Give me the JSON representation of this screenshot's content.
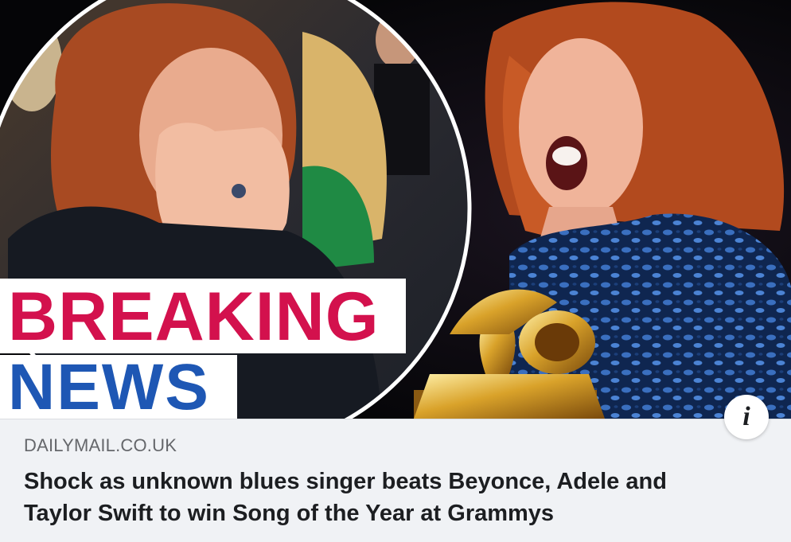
{
  "post": {
    "badge": {
      "line1": "BREAKING",
      "line2": "NEWS"
    },
    "info_icon": "info-icon",
    "info_glyph": "i",
    "domain": "DAILYMAIL.CO.UK",
    "headline": "Shock as unknown blues singer beats Beyonce, Adele and Taylor Swift to win Song of the Year at Grammys"
  },
  "colors": {
    "breaking_red": "#d3114d",
    "news_blue": "#1e57b4",
    "meta_background": "#f0f2f5",
    "domain_gray": "#65676b",
    "headline_black": "#1c1e21"
  }
}
